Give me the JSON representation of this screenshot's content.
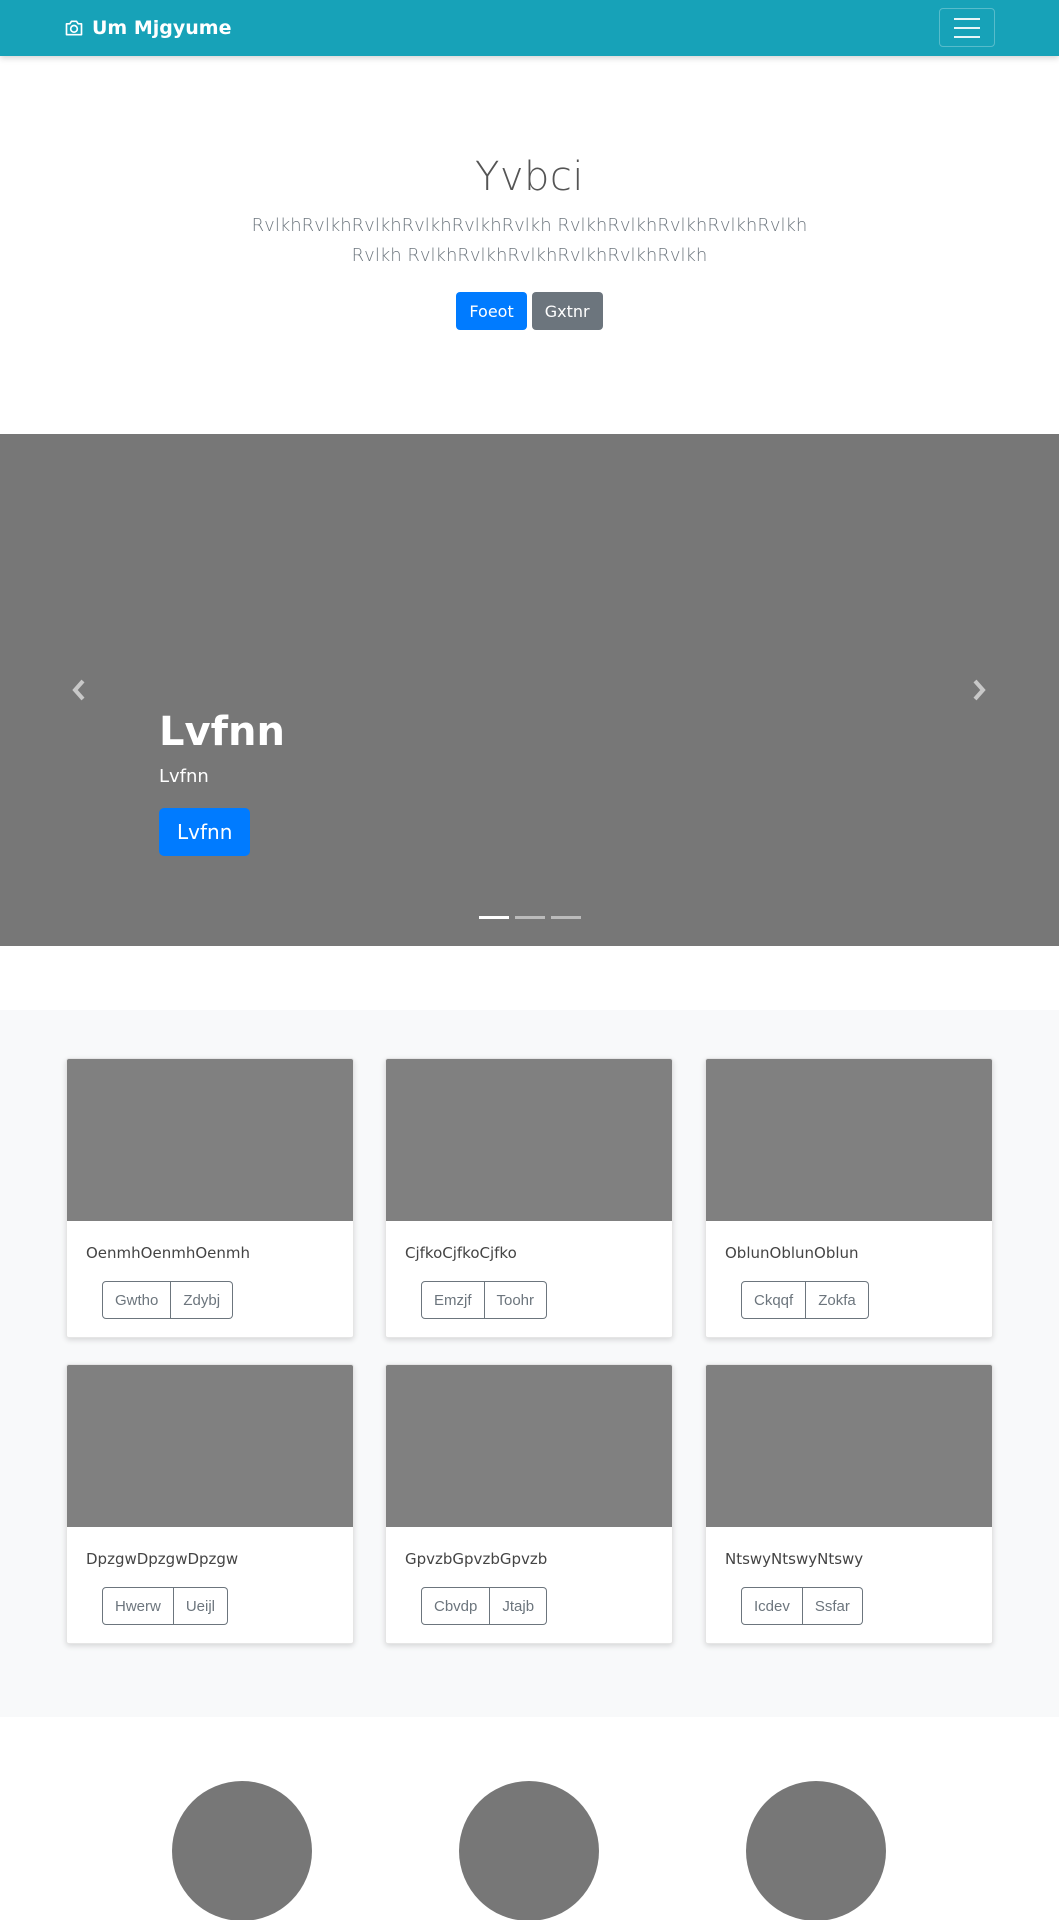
{
  "navbar": {
    "brand": "Um Mjgyume",
    "brand_icon": "camera-icon",
    "toggler_icon": "hamburger-menu-icon",
    "background": "#17a2b8"
  },
  "hero": {
    "title": "Yvbci",
    "lead": "RvlkhRvlkhRvlkhRvlkhRvlkhRvlkh RvlkhRvlkhRvlkhRvlkhRvlkhRvlkh RvlkhRvlkhRvlkhRvlkhRvlkhRvlkh",
    "primary_button": "Foeot",
    "secondary_button": "Gxtnr"
  },
  "carousel": {
    "title": "Lvfnn",
    "subtitle": "Lvfnn",
    "button": "Lvfnn",
    "prev_icon": "chevron-left-icon",
    "next_icon": "chevron-right-icon",
    "slide_count": 3,
    "active_slide": 1
  },
  "cards": [
    {
      "text": "OenmhOenmhOenmh",
      "buttons": [
        "Gwtho",
        "Zdybj"
      ]
    },
    {
      "text": "CjfkoCjfkoCjfko",
      "buttons": [
        "Emzjf",
        "Toohr"
      ]
    },
    {
      "text": "OblunOblunOblun",
      "buttons": [
        "Ckqqf",
        "Zokfa"
      ]
    },
    {
      "text": "DpzgwDpzgwDpzgw",
      "buttons": [
        "Hwerw",
        "Ueijl"
      ]
    },
    {
      "text": "GpvzbGpvzbGpvzb",
      "buttons": [
        "Cbvdp",
        "Jtajb"
      ]
    },
    {
      "text": "NtswyNtswyNtswy",
      "buttons": [
        "Icdev",
        "Ssfar"
      ]
    }
  ],
  "colors": {
    "primary": "#007bff",
    "secondary": "#6c757d",
    "placeholder": "#777777"
  }
}
